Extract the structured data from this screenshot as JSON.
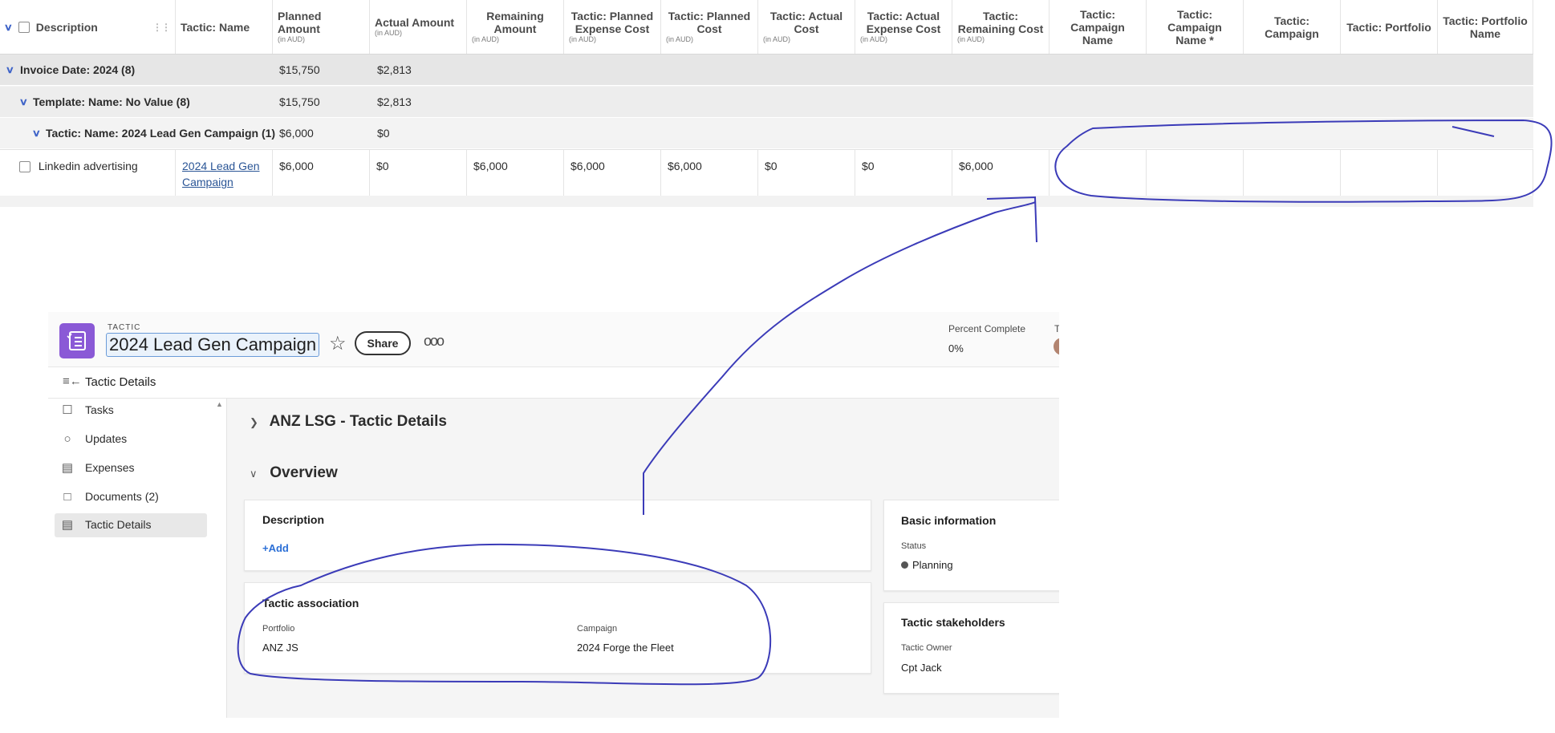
{
  "grid": {
    "headers": [
      {
        "label": "Description",
        "sub": ""
      },
      {
        "label": "Tactic: Name",
        "sub": ""
      },
      {
        "label": "Planned Amount",
        "sub": "(in AUD)"
      },
      {
        "label": "Actual Amount",
        "sub": "(in AUD)"
      },
      {
        "label": "Remaining Amount",
        "sub": "(in AUD)"
      },
      {
        "label": "Tactic: Planned Expense Cost",
        "sub": "(in AUD)"
      },
      {
        "label": "Tactic: Planned Cost",
        "sub": "(in AUD)"
      },
      {
        "label": "Tactic: Actual Cost",
        "sub": "(in AUD)"
      },
      {
        "label": "Tactic: Actual Expense Cost",
        "sub": "(in AUD)"
      },
      {
        "label": "Tactic: Remaining Cost",
        "sub": "(in AUD)"
      },
      {
        "label": "Tactic: Campaign Name",
        "sub": ""
      },
      {
        "label": "Tactic: Campaign Name *",
        "sub": ""
      },
      {
        "label": "Tactic: Campaign",
        "sub": ""
      },
      {
        "label": "Tactic: Portfolio",
        "sub": ""
      },
      {
        "label": "Tactic: Portfolio Name",
        "sub": ""
      }
    ],
    "groups": [
      {
        "label": "Invoice Date: 2024 (8)",
        "planned": "$15,750",
        "actual": "$2,813"
      },
      {
        "label": "Template: Name: No Value (8)",
        "planned": "$15,750",
        "actual": "$2,813"
      },
      {
        "label": "Tactic: Name: 2024 Lead Gen Campaign (1)",
        "planned": "$6,000",
        "actual": "$0"
      }
    ],
    "row": {
      "description": "Linkedin advertising",
      "tactic_name": "2024 Lead Gen Campaign",
      "values": [
        "$6,000",
        "$0",
        "$6,000",
        "$6,000",
        "$6,000",
        "$0",
        "$0",
        "$6,000"
      ]
    }
  },
  "tactic": {
    "object_label": "TACTIC",
    "title": "2024 Lead Gen Campaign",
    "share_label": "Share",
    "more_label": "ooo",
    "percent_complete_label": "Percent Complete",
    "percent_complete_value": "0%",
    "cut_label": "T",
    "nav_title": "Tactic Details",
    "sidebar": [
      {
        "label": "Tasks",
        "icon": "task-icon"
      },
      {
        "label": "Updates",
        "icon": "updates-icon"
      },
      {
        "label": "Expenses",
        "icon": "expenses-icon"
      },
      {
        "label": "Documents (2)",
        "icon": "documents-icon"
      },
      {
        "label": "Tactic Details",
        "icon": "details-icon",
        "active": true
      }
    ],
    "section_collapsed": "ANZ LSG - Tactic Details",
    "section_overview": "Overview",
    "description_card": {
      "title": "Description",
      "add_label": "+Add"
    },
    "association_card": {
      "title": "Tactic association",
      "portfolio_label": "Portfolio",
      "portfolio_value": "ANZ JS",
      "campaign_label": "Campaign",
      "campaign_value": "2024 Forge the Fleet"
    },
    "basic_card": {
      "title": "Basic information",
      "status_label": "Status",
      "status_value": "Planning"
    },
    "stakeholders_card": {
      "title": "Tactic stakeholders",
      "owner_label": "Tactic Owner",
      "owner_value": "Cpt Jack"
    }
  },
  "colors": {
    "accent": "#3f64c8",
    "link": "#2a5596",
    "tactic_icon": "#8a59d6",
    "annotation": "#3b3bb8"
  }
}
